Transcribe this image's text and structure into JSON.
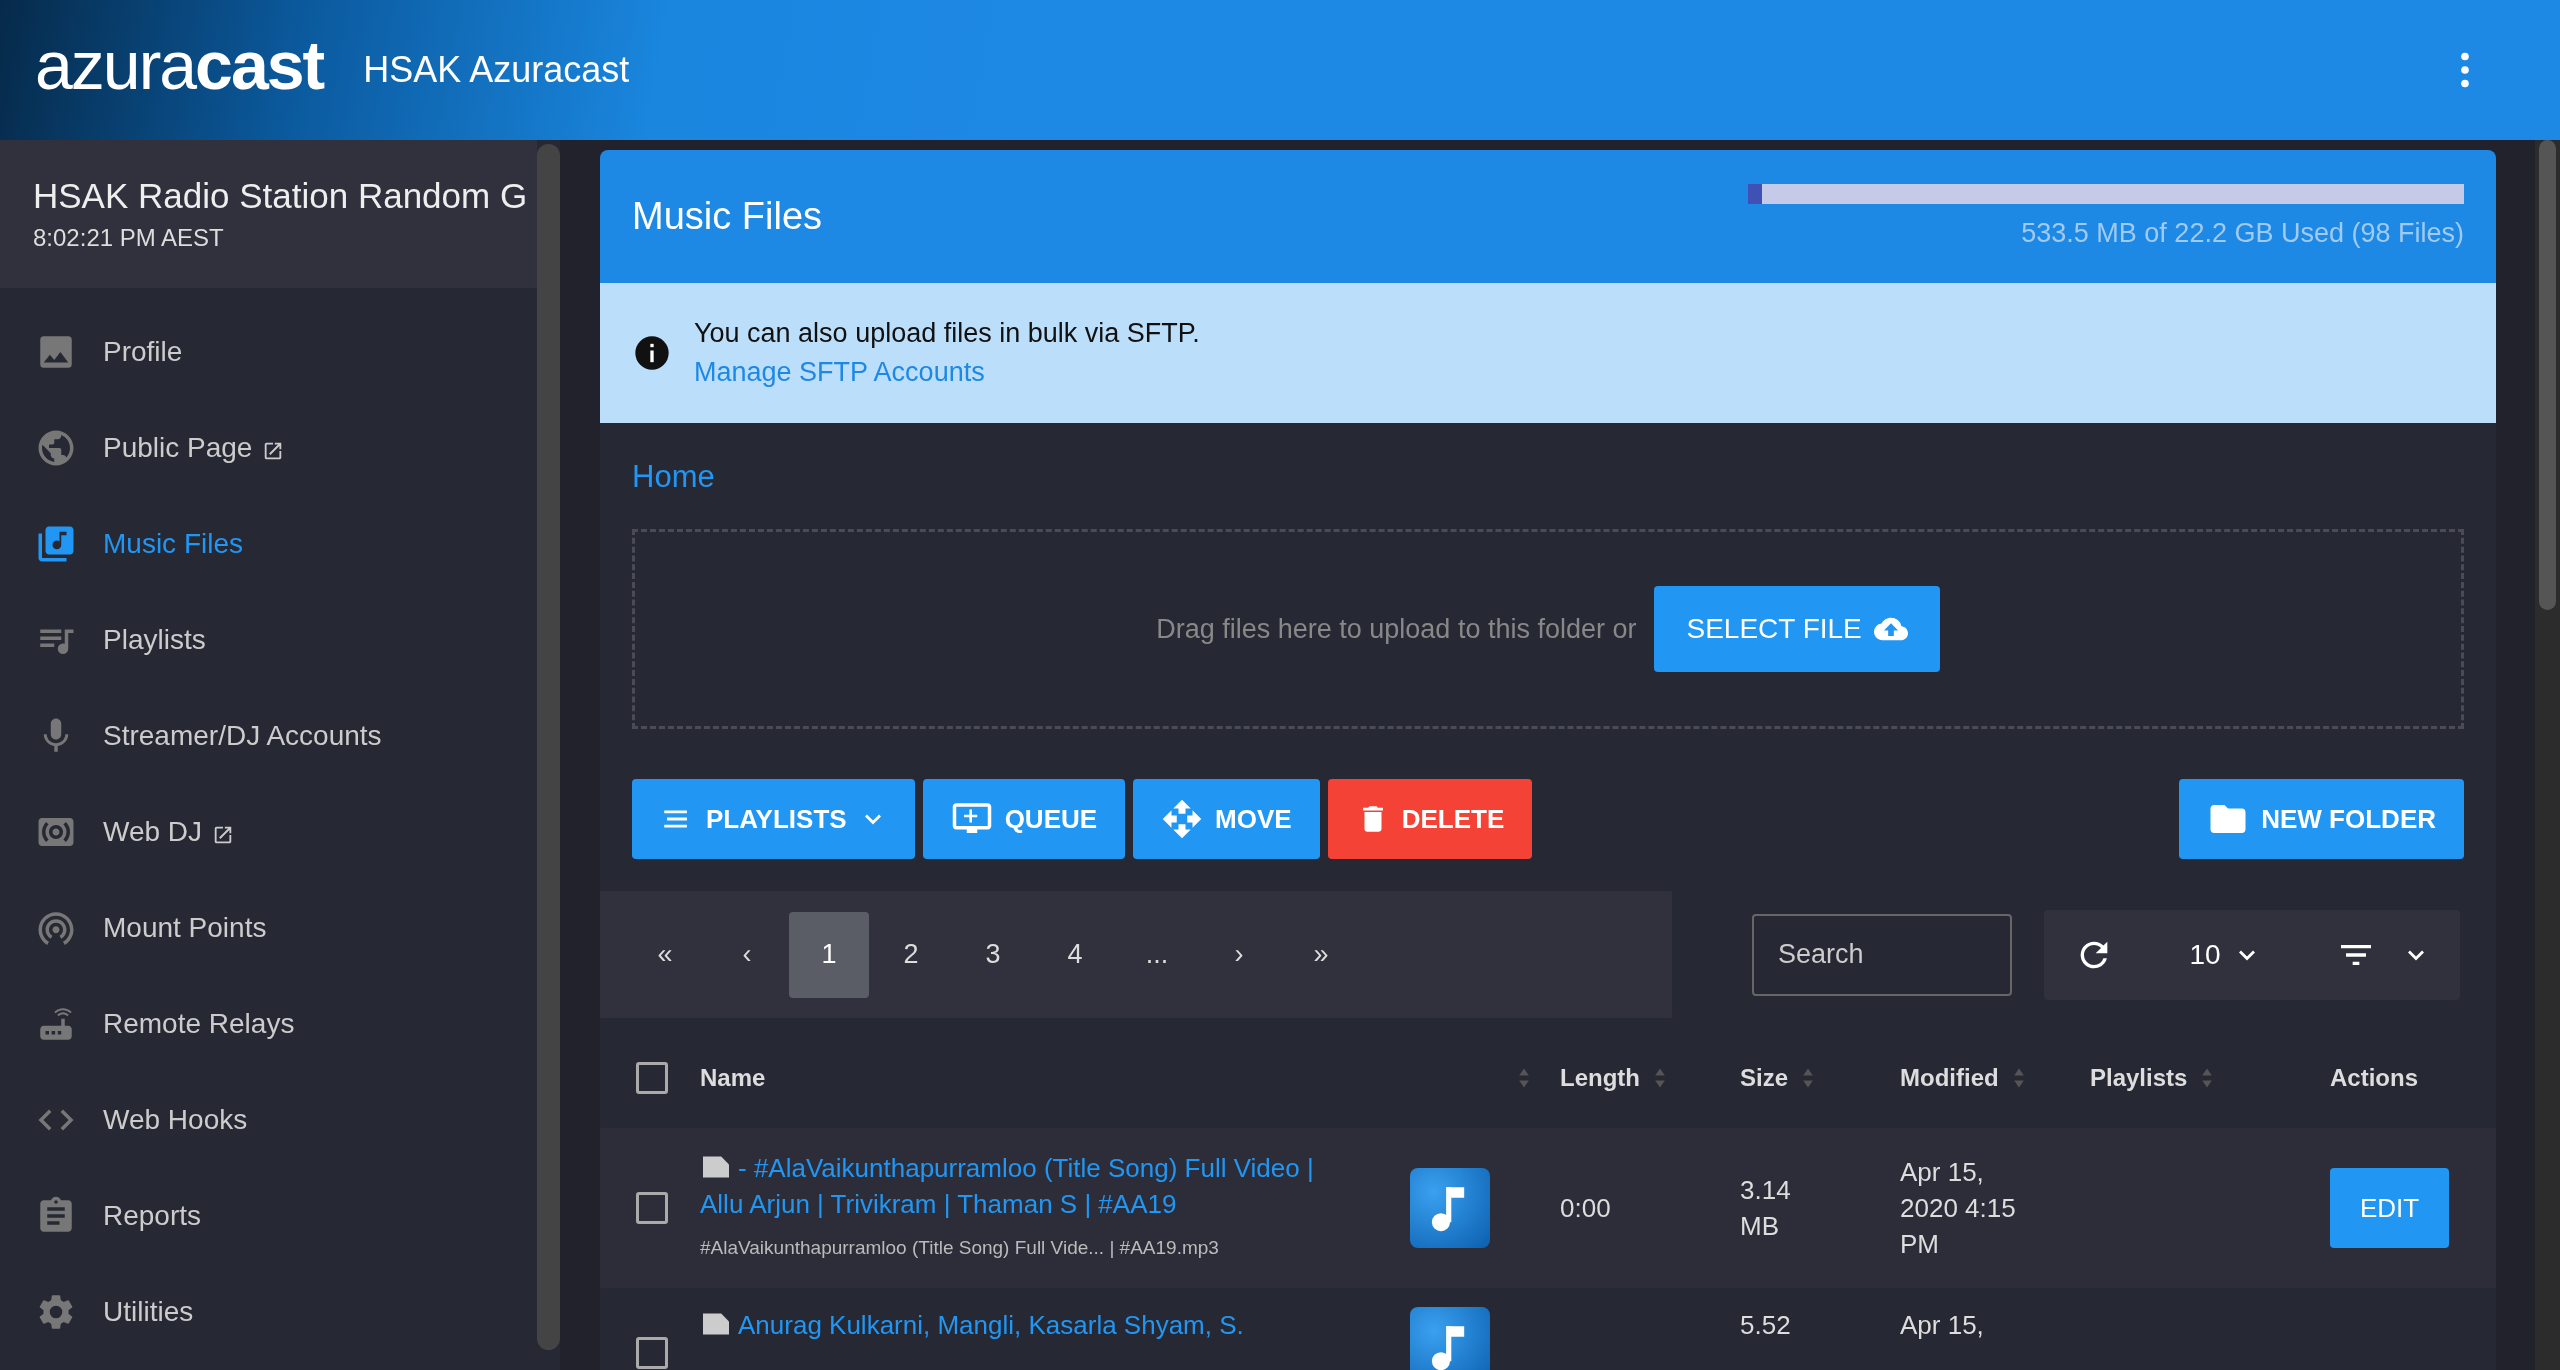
{
  "header": {
    "logo": "azura**cast**",
    "title": "HSAK Azuracast"
  },
  "sidebar": {
    "station_name": "HSAK Radio Station Random G",
    "time": "8:02:21 PM AEST",
    "items": [
      {
        "label": "Profile",
        "selected": false,
        "external": false
      },
      {
        "label": "Public Page",
        "selected": false,
        "external": true
      },
      {
        "label": "Music Files",
        "selected": true,
        "external": false
      },
      {
        "label": "Playlists",
        "selected": false,
        "external": false
      },
      {
        "label": "Streamer/DJ Accounts",
        "selected": false,
        "external": false
      },
      {
        "label": "Web DJ",
        "selected": false,
        "external": true
      },
      {
        "label": "Mount Points",
        "selected": false,
        "external": false
      },
      {
        "label": "Remote Relays",
        "selected": false,
        "external": false
      },
      {
        "label": "Web Hooks",
        "selected": false,
        "external": false
      },
      {
        "label": "Reports",
        "selected": false,
        "external": false
      },
      {
        "label": "Utilities",
        "selected": false,
        "external": false
      }
    ]
  },
  "card": {
    "title": "Music Files",
    "storage": {
      "level": 0.02,
      "reading": "533.5 MB of 22.2 GB Used (98 Files)"
    },
    "notice": {
      "text": "You can also upload files in bulk via SFTP.",
      "link": "Manage SFTP Accounts"
    },
    "breadcrumb": "Home",
    "dropzone": {
      "text": "Drag files here to upload to this folder or",
      "button": "SELECT FILE"
    },
    "actions": [
      {
        "label": "PLAYLISTS",
        "kind": "playlists"
      },
      {
        "label": "QUEUE",
        "kind": "queue"
      },
      {
        "label": "MOVE",
        "kind": "move"
      },
      {
        "label": "DELETE",
        "kind": "delete"
      }
    ],
    "new_folder": "NEW FOLDER",
    "pagination": [
      {
        "label": "«",
        "selected": false
      },
      {
        "label": "‹",
        "selected": false
      },
      {
        "label": "1",
        "selected": true
      },
      {
        "label": "2",
        "selected": false
      },
      {
        "label": "3",
        "selected": false
      },
      {
        "label": "4",
        "selected": false
      },
      {
        "label": "...",
        "selected": false
      },
      {
        "label": "›",
        "selected": false
      },
      {
        "label": "»",
        "selected": false
      }
    ],
    "search": {
      "placeholder": "Search"
    },
    "per_page": "10",
    "table": {
      "select_all_checked": false,
      "columns": [
        {
          "label": "Name",
          "sortable": true
        },
        {
          "label": "Length",
          "sortable": true
        },
        {
          "label": "Size",
          "sortable": true
        },
        {
          "label": "Modified",
          "sortable": true
        },
        {
          "label": "Playlists",
          "sortable": true
        },
        {
          "label": "Actions",
          "sortable": false
        }
      ],
      "rows": [
        {
          "checked": false,
          "title": "- #AlaVaikunthapurramloo (Title Song) Full Video | Allu Arjun | Trivikram | Thaman S | #AA19",
          "filename": "#AlaVaikunthapurramloo (Title Song) Full Vide... | #AA19.mp3",
          "length": "0:00",
          "size": "3.14 MB",
          "modified": "Apr 15, 2020 4:15 PM",
          "edit": "EDIT"
        },
        {
          "checked": false,
          "title": "Anurag Kulkarni, Mangli, Kasarla Shyam, S.",
          "size": "5.52",
          "modified": "Apr 15,"
        }
      ]
    }
  }
}
